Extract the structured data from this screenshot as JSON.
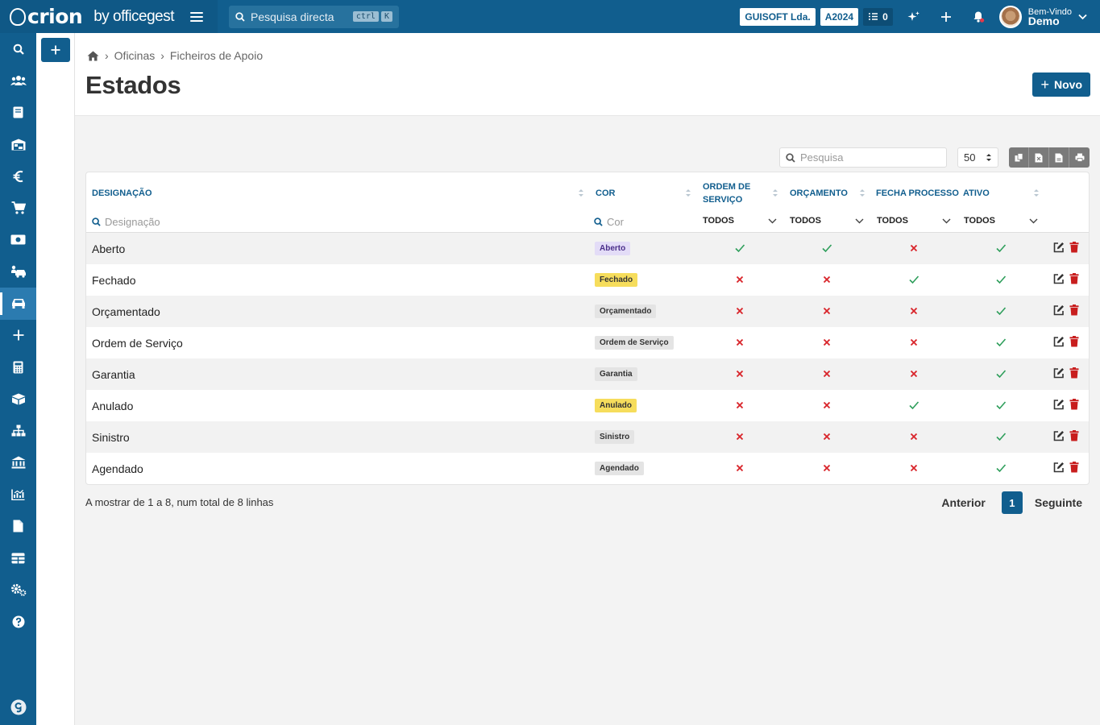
{
  "brand": {
    "name": "crion",
    "by": "by officegest"
  },
  "topbar": {
    "search_placeholder": "Pesquisa directa",
    "kbd": [
      "ctrl",
      "K"
    ],
    "company": "GUISOFT Lda.",
    "year": "A2024",
    "tasks_count": "0",
    "greeting": "Bem-Vindo",
    "user_name": "Demo"
  },
  "sidebar": {
    "items": [
      "search-icon",
      "users-icon",
      "book-icon",
      "warehouse-icon",
      "euro-icon",
      "cart-icon",
      "money-icon",
      "car-people-icon",
      "car-icon",
      "plus-icon",
      "calculator-icon",
      "box-icon",
      "hierarchy-icon",
      "bank-icon",
      "chart-icon",
      "file-icon",
      "table-icon",
      "gears-icon",
      "help-icon"
    ],
    "active_index": 8
  },
  "breadcrumb": {
    "items": [
      "Oficinas",
      "Ficheiros de Apoio"
    ]
  },
  "page": {
    "title": "Estados",
    "new_button": "Novo"
  },
  "tools": {
    "search_placeholder": "Pesquisa",
    "page_size": "50"
  },
  "table": {
    "columns": {
      "designacao": "DESIGNAÇÃO",
      "cor": "COR",
      "ordem_servico": [
        "ORDEM DE",
        "SERVIÇO"
      ],
      "orcamento": "ORÇAMENTO",
      "fecha_processo": "FECHA PROCESSO",
      "ativo": "ATIVO"
    },
    "filters": {
      "designacao_placeholder": "Designação",
      "cor_placeholder": "Cor",
      "all": "TODOS"
    },
    "rows": [
      {
        "name": "Aberto",
        "badge": "Aberto",
        "badge_bg": "#e3dcf7",
        "badge_fg": "#4b2f8a",
        "os": true,
        "orc": true,
        "fecha": false,
        "ativo": true
      },
      {
        "name": "Fechado",
        "badge": "Fechado",
        "badge_bg": "#f6dd5c",
        "badge_fg": "#333333",
        "os": false,
        "orc": false,
        "fecha": true,
        "ativo": true
      },
      {
        "name": "Orçamentado",
        "badge": "Orçamentado",
        "badge_bg": "#e4e4e4",
        "badge_fg": "#333333",
        "os": false,
        "orc": false,
        "fecha": false,
        "ativo": true
      },
      {
        "name": "Ordem de Serviço",
        "badge": "Ordem de Serviço",
        "badge_bg": "#e4e4e4",
        "badge_fg": "#333333",
        "os": false,
        "orc": false,
        "fecha": false,
        "ativo": true
      },
      {
        "name": "Garantia",
        "badge": "Garantia",
        "badge_bg": "#e4e4e4",
        "badge_fg": "#333333",
        "os": false,
        "orc": false,
        "fecha": false,
        "ativo": true
      },
      {
        "name": "Anulado",
        "badge": "Anulado",
        "badge_bg": "#f6dd5c",
        "badge_fg": "#333333",
        "os": false,
        "orc": false,
        "fecha": true,
        "ativo": true
      },
      {
        "name": "Sinistro",
        "badge": "Sinistro",
        "badge_bg": "#e4e4e4",
        "badge_fg": "#333333",
        "os": false,
        "orc": false,
        "fecha": false,
        "ativo": true
      },
      {
        "name": "Agendado",
        "badge": "Agendado",
        "badge_bg": "#e4e4e4",
        "badge_fg": "#333333",
        "os": false,
        "orc": false,
        "fecha": false,
        "ativo": true
      }
    ]
  },
  "footer": {
    "info": "A mostrar de 1 a 8, num total de 8 linhas",
    "prev": "Anterior",
    "page": "1",
    "next": "Seguinte"
  },
  "colors": {
    "primary": "#115e8e",
    "check": "#2e9e5b",
    "cross": "#d9262c",
    "delete": "#c81e1e"
  }
}
